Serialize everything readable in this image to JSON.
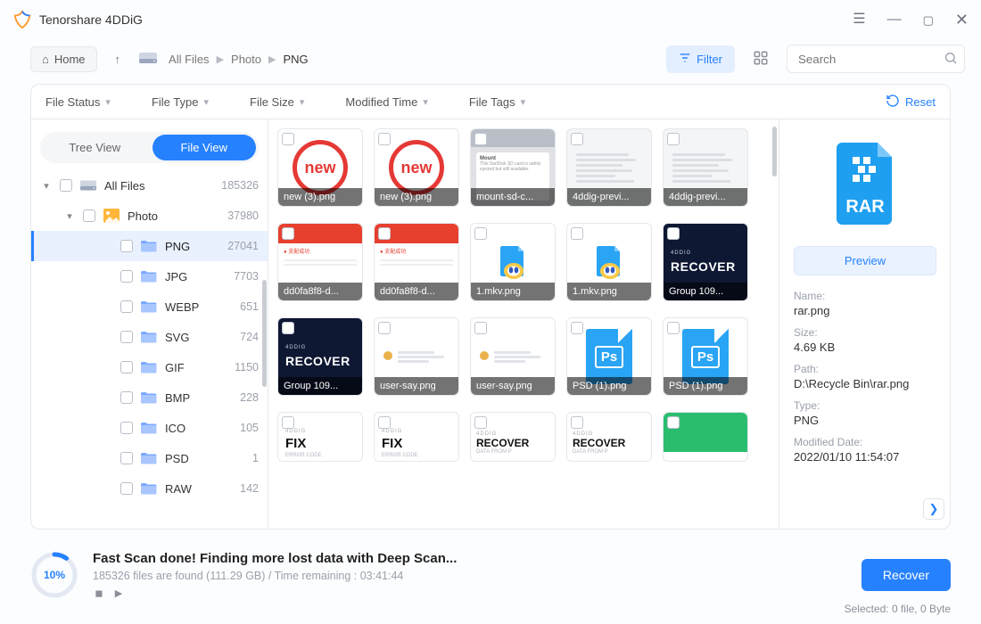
{
  "app": {
    "title": "Tenorshare 4DDiG"
  },
  "topbar": {
    "home": "Home",
    "crumbs": [
      "All Files",
      "Photo",
      "PNG"
    ],
    "filter": "Filter",
    "search_placeholder": "Search"
  },
  "filters": {
    "items": [
      "File Status",
      "File Type",
      "File Size",
      "Modified Time",
      "File Tags"
    ],
    "reset": "Reset"
  },
  "viewSwitch": {
    "tree": "Tree View",
    "file": "File View"
  },
  "tree": {
    "root": {
      "label": "All Files",
      "count": "185326"
    },
    "photo": {
      "label": "Photo",
      "count": "37980"
    },
    "children": [
      {
        "label": "PNG",
        "count": "27041",
        "selected": true
      },
      {
        "label": "JPG",
        "count": "7703"
      },
      {
        "label": "WEBP",
        "count": "651"
      },
      {
        "label": "SVG",
        "count": "724"
      },
      {
        "label": "GIF",
        "count": "1150"
      },
      {
        "label": "BMP",
        "count": "228"
      },
      {
        "label": "ICO",
        "count": "105"
      },
      {
        "label": "PSD",
        "count": "1"
      },
      {
        "label": "RAW",
        "count": "142"
      }
    ]
  },
  "grid": [
    {
      "k": "new",
      "cap": "new (3).png"
    },
    {
      "k": "new",
      "cap": "new (3).png"
    },
    {
      "k": "mount",
      "cap": "mount-sd-c..."
    },
    {
      "k": "doc",
      "cap": "4ddig-previ..."
    },
    {
      "k": "doc",
      "cap": "4ddig-previ..."
    },
    {
      "k": "red",
      "cap": "dd0fa8f8-d..."
    },
    {
      "k": "red",
      "cap": "dd0fa8f8-d..."
    },
    {
      "k": "mkv",
      "cap": "1.mkv.png"
    },
    {
      "k": "mkv",
      "cap": "1.mkv.png"
    },
    {
      "k": "recover",
      "cap": "Group 109..."
    },
    {
      "k": "recover",
      "cap": "Group 109..."
    },
    {
      "k": "chat",
      "cap": "user-say.png"
    },
    {
      "k": "chat",
      "cap": "user-say.png"
    },
    {
      "k": "ps",
      "cap": "PSD (1).png"
    },
    {
      "k": "ps",
      "cap": "PSD (1).png"
    },
    {
      "k": "fix",
      "cap": "",
      "part": true
    },
    {
      "k": "fix",
      "cap": "",
      "part": true
    },
    {
      "k": "recov2",
      "cap": "",
      "part": true
    },
    {
      "k": "recov2",
      "cap": "",
      "part": true
    },
    {
      "k": "green",
      "cap": "",
      "part": true
    }
  ],
  "thumbText": {
    "new": "new",
    "fourddig": "4DDIG",
    "recover": "RECOVER",
    "fix": "FIX",
    "fixerr": "ERROR CODE",
    "recovdata": "DATA FROM P"
  },
  "preview": {
    "button": "Preview",
    "labels": {
      "name": "Name:",
      "size": "Size:",
      "path": "Path:",
      "type": "Type:",
      "modified": "Modified Date:"
    },
    "values": {
      "name": "rar.png",
      "size": "4.69 KB",
      "path": "D:\\Recycle Bin\\rar.png",
      "type": "PNG",
      "modified": "2022/01/10 11:54:07"
    },
    "rar_label": "RAR"
  },
  "footer": {
    "percent": "10%",
    "headline": "Fast Scan done! Finding more lost data with Deep Scan...",
    "subline": "185326 files are found (111.29 GB)  /  Time remaining : 03:41:44",
    "recover": "Recover",
    "selected": "Selected: 0 file, 0 Byte"
  }
}
